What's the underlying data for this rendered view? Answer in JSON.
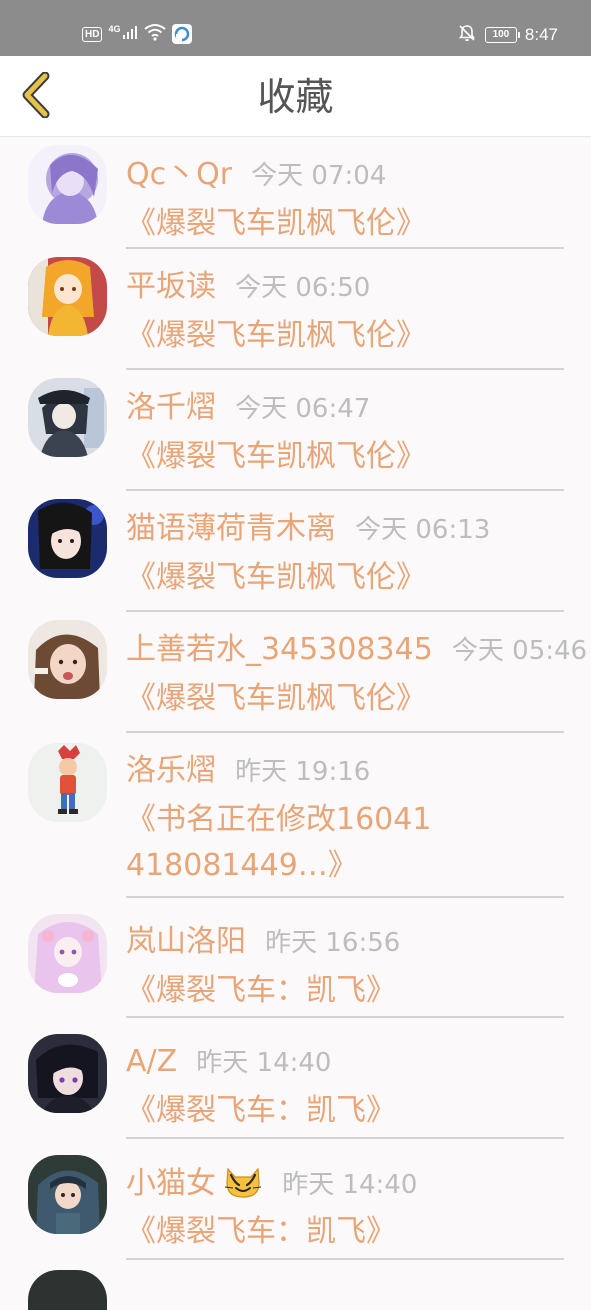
{
  "status_bar": {
    "hd_label": "HD",
    "network_label": "4G",
    "battery_level": "100",
    "time": "8:47"
  },
  "header": {
    "title": "收藏"
  },
  "favorites": [
    {
      "user": "Qc丶Qr",
      "time": "今天 07:04",
      "book": "《爆裂飞车凯枫飞伦》"
    },
    {
      "user": "平坂读",
      "time": "今天 06:50",
      "book": "《爆裂飞车凯枫飞伦》"
    },
    {
      "user": "洛千熠",
      "time": "今天 06:47",
      "book": "《爆裂飞车凯枫飞伦》"
    },
    {
      "user": "猫语薄荷青木离",
      "time": "今天 06:13",
      "book": "《爆裂飞车凯枫飞伦》"
    },
    {
      "user": "上善若水_345308345",
      "time": "今天 05:46",
      "book": "《爆裂飞车凯枫飞伦》"
    },
    {
      "user": "洛乐熠",
      "time": "昨天 19:16",
      "book": "《书名正在修改16041418081449…》"
    },
    {
      "user": "岚山洛阳",
      "time": "昨天 16:56",
      "book": "《爆裂飞车：凯飞》"
    },
    {
      "user": "A/Z",
      "time": "昨天 14:40",
      "book": "《爆裂飞车：凯飞》"
    },
    {
      "user": "小猫女",
      "time": "昨天 14:40",
      "book": "《爆裂飞车：凯飞》"
    }
  ],
  "colors": {
    "accent": "#e8a577",
    "timestamp": "#bdbdbd",
    "status_bar": "#8c8c8c",
    "back_arrow": "#e6c24a"
  }
}
